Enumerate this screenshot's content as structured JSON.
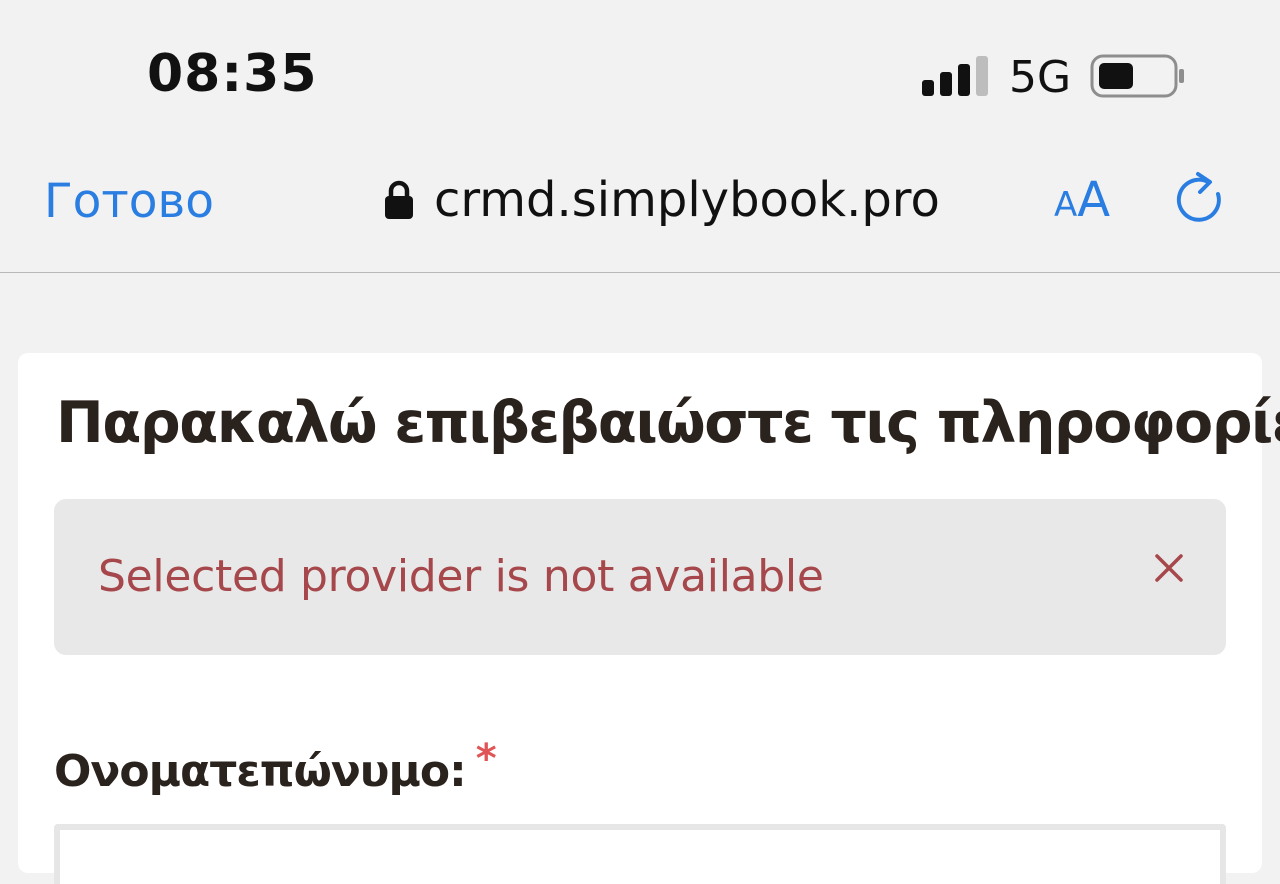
{
  "status_bar": {
    "time": "08:35",
    "network": "5G",
    "signal_icon": "cellular-signal-icon",
    "battery_icon": "battery-icon"
  },
  "browser": {
    "done_label": "Готово",
    "url": "crmd.simplybook.pro",
    "text_size_small": "A",
    "text_size_big": "A",
    "lock_icon": "lock-icon",
    "reload_icon": "reload-icon",
    "accent_color": "#2a7de1"
  },
  "page": {
    "title": "Παρακαλώ επιβεβαιώστε τις πληροφορίες",
    "alert": {
      "message": "Selected provider is not available",
      "close_symbol": "×",
      "text_color": "#a6474b"
    },
    "form": {
      "name_label": "Ονοματεπώνυμο:",
      "required_mark": "*"
    }
  }
}
